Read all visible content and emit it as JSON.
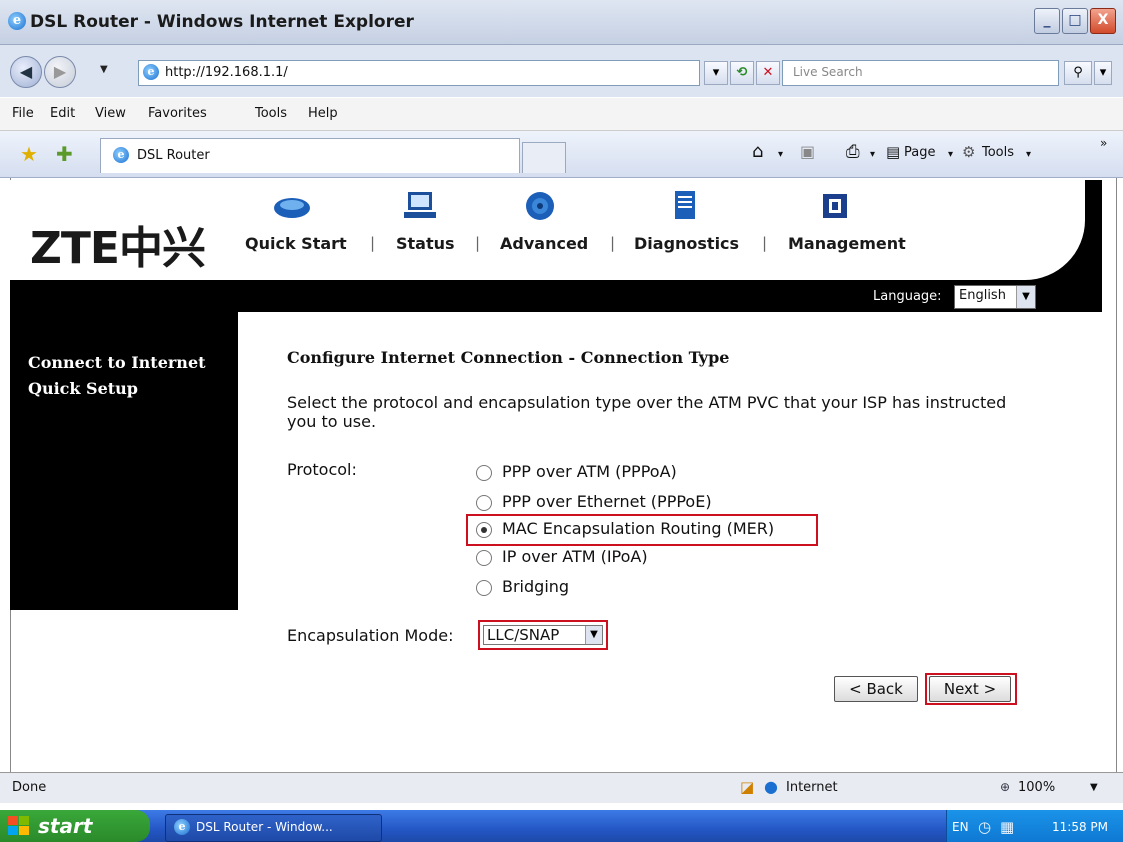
{
  "window": {
    "title": "DSL Router - Windows Internet Explorer",
    "minimize": "_",
    "maximize": "□",
    "close": "X"
  },
  "addressbar": {
    "url": "http://192.168.1.1/",
    "search_placeholder": "Live Search"
  },
  "menu": [
    "File",
    "Edit",
    "View",
    "Favorites",
    "Tools",
    "Help"
  ],
  "tab": {
    "title": "DSL Router"
  },
  "toolbar": {
    "page_label": "Page",
    "tools_label": "Tools"
  },
  "router": {
    "logo": "ZTE中兴",
    "nav": [
      "Quick Start",
      "Status",
      "Advanced",
      "Diagnostics",
      "Management"
    ],
    "language_label": "Language:",
    "language_value": "English",
    "sidebar_title": "Connect to Internet Quick Setup",
    "heading": "Configure Internet Connection - Connection Type",
    "description": "Select the protocol and encapsulation type over the ATM PVC that your ISP has instructed you to use.",
    "protocol_label": "Protocol:",
    "protocols": [
      {
        "label": "PPP over ATM (PPPoA)",
        "selected": false
      },
      {
        "label": "PPP over Ethernet (PPPoE)",
        "selected": false
      },
      {
        "label": "MAC Encapsulation Routing (MER)",
        "selected": true
      },
      {
        "label": "IP over ATM (IPoA)",
        "selected": false
      },
      {
        "label": "Bridging",
        "selected": false
      }
    ],
    "encap_label": "Encapsulation Mode:",
    "encap_value": "LLC/SNAP",
    "back_label": "< Back",
    "next_label": "Next >"
  },
  "statusbar": {
    "status": "Done",
    "zone": "Internet",
    "zoom": "100%"
  },
  "taskbar": {
    "start": "start",
    "item": "DSL Router - Window...",
    "lang": "EN",
    "time": "11:58 PM"
  },
  "colors": {
    "highlight": "#cc1020",
    "taskbar": "#2457c5",
    "start": "#2a8a2a"
  }
}
